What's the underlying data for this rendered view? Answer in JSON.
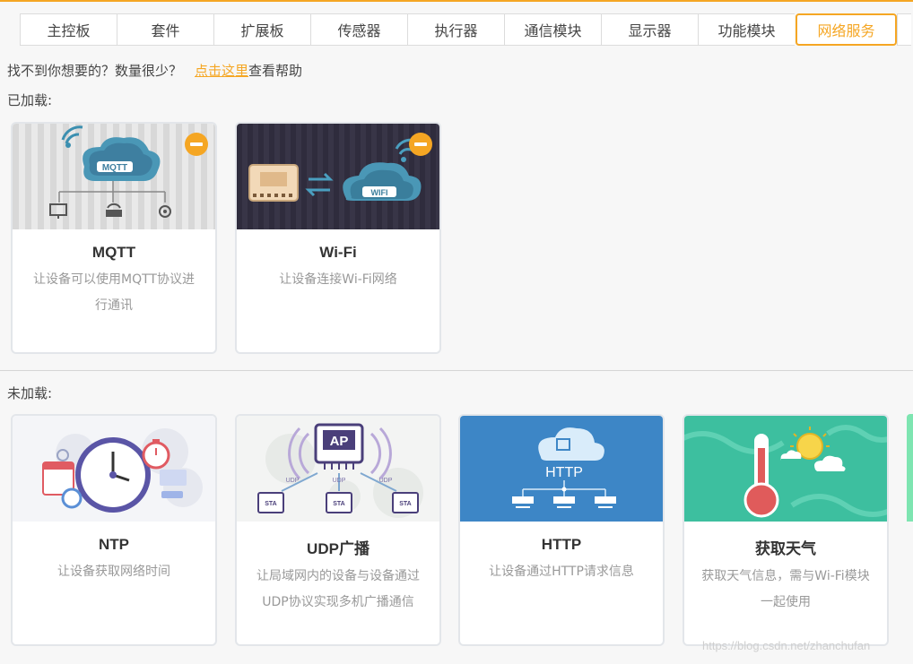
{
  "tabs": [
    {
      "label": "主控板"
    },
    {
      "label": "套件"
    },
    {
      "label": "扩展板"
    },
    {
      "label": "传感器"
    },
    {
      "label": "执行器"
    },
    {
      "label": "通信模块"
    },
    {
      "label": "显示器"
    },
    {
      "label": "功能模块"
    },
    {
      "label": "网络服务",
      "active": true
    }
  ],
  "help": {
    "prefix": "找不到你想要的？数量很少？",
    "link": "点击这里",
    "suffix": "查看帮助"
  },
  "loaded": {
    "label": "已加载:",
    "cards": [
      {
        "title": "MQTT",
        "desc": "让设备可以使用MQTT协议进行通讯",
        "icon": "mqtt-cloud-network-icon",
        "thumb_text": "MQTT"
      },
      {
        "title": "Wi-Fi",
        "desc": "让设备连接Wi-Fi网络",
        "icon": "wifi-board-cloud-icon",
        "thumb_text": "WIFI"
      }
    ]
  },
  "unloaded": {
    "label": "未加载:",
    "cards": [
      {
        "title": "NTP",
        "desc": "让设备获取网络时间",
        "icon": "clock-icon"
      },
      {
        "title": "UDP广播",
        "desc": "让局域网内的设备与设备通过UDP协议实现多机广播通信",
        "icon": "ap-broadcast-icon",
        "thumb_text": "AP",
        "node_label": "STA",
        "link_label": "UDP"
      },
      {
        "title": "HTTP",
        "desc": "让设备通过HTTP请求信息",
        "icon": "http-cloud-icon",
        "thumb_text": "HTTP"
      },
      {
        "title": "获取天气",
        "desc": "获取天气信息，需与Wi-Fi模块一起使用",
        "icon": "thermometer-sun-icon"
      }
    ]
  },
  "watermark": "https://blog.csdn.net/zhanchufan",
  "colors": {
    "accent": "#f5a623",
    "http_blue": "#3d86c6",
    "weather_teal": "#3dbf9f"
  }
}
